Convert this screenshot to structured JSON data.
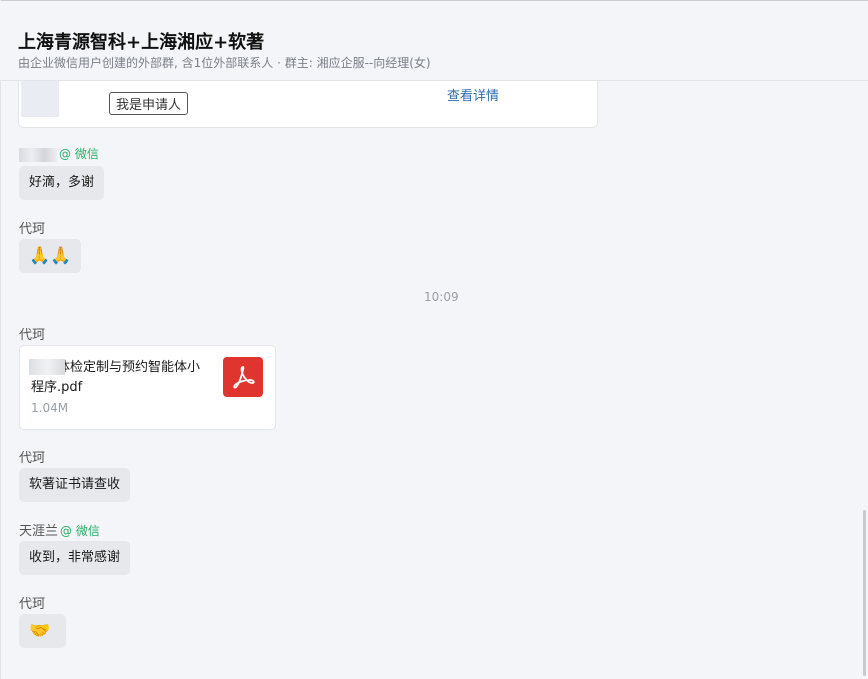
{
  "header": {
    "title": "上海青源智科+上海湘应+软著",
    "subtitle": "由企业微信用户创建的外部群, 含1位外部联系人 · 群主: 湘应企服--向经理(女)"
  },
  "top_card": {
    "link": "查看详情",
    "tag": "我是申请人"
  },
  "messages": [
    {
      "sender": "",
      "suffix": "@ 微信",
      "text": "好滴，多谢"
    },
    {
      "sender": "代珂",
      "text": "🙏🙏"
    },
    {
      "time": "10:09"
    },
    {
      "sender": "代珂",
      "file": {
        "name": "健康体检定制与预约智能体小程序.pdf",
        "size": "1.04M"
      }
    },
    {
      "sender": "代珂",
      "text": "软著证书请查收"
    },
    {
      "sender": "天涯兰",
      "suffix": "@ 微信",
      "text": "收到，非常感谢"
    },
    {
      "sender": "代珂",
      "text": "🤝"
    }
  ],
  "colors": {
    "wechat_green": "#2aae67",
    "link_blue": "#2b6cb0",
    "pdf_red": "#e0342f"
  },
  "icons": {
    "file": "pdf-icon"
  }
}
